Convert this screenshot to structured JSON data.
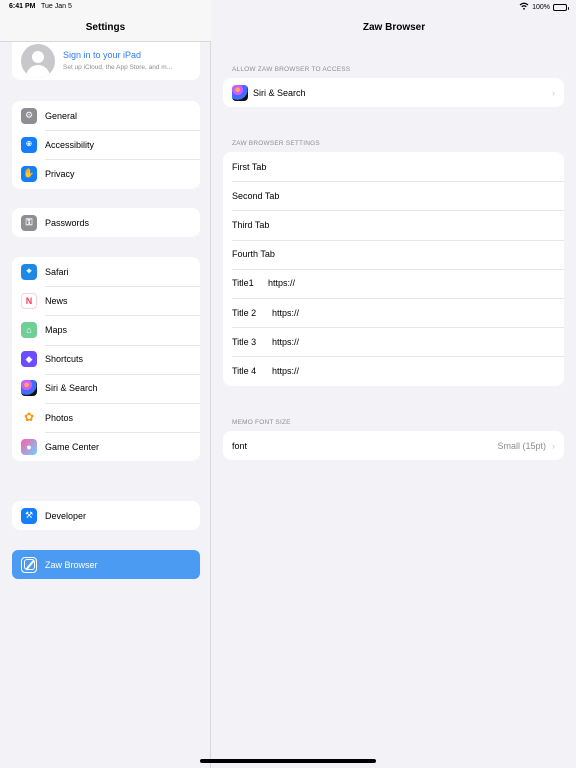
{
  "status": {
    "time": "6:41 PM",
    "date": "Tue Jan 5",
    "battery": "100%"
  },
  "sidebar": {
    "title": "Settings",
    "profile": {
      "title": "Sign in to your iPad",
      "subtitle": "Set up iCloud, the App Store, and m..."
    },
    "groups": [
      [
        {
          "label": "General",
          "icon": "gear-icon",
          "color": "#8e8e93"
        },
        {
          "label": "Accessibility",
          "icon": "accessibility-icon",
          "color": "#147efb"
        },
        {
          "label": "Privacy",
          "icon": "hand-icon",
          "color": "#147efb"
        }
      ],
      [
        {
          "label": "Passwords",
          "icon": "key-icon",
          "color": "#8e8e93"
        }
      ],
      [
        {
          "label": "Safari",
          "icon": "compass-icon",
          "color": "#1e88e5"
        },
        {
          "label": "News",
          "icon": "news-icon",
          "color": "#ff3b58"
        },
        {
          "label": "Maps",
          "icon": "maps-icon",
          "color": "#6fcf97"
        },
        {
          "label": "Shortcuts",
          "icon": "shortcuts-icon",
          "color": "#6d4dff"
        },
        {
          "label": "Siri & Search",
          "icon": "siri-icon",
          "color": "#222"
        },
        {
          "label": "Photos",
          "icon": "photos-icon",
          "color": "#ff9500"
        },
        {
          "label": "Game Center",
          "icon": "game-center-icon",
          "color": "#ff5ea8"
        }
      ],
      [
        {
          "label": "Developer",
          "icon": "hammer-icon",
          "color": "#147efb"
        }
      ]
    ],
    "selected": {
      "label": "Zaw Browser",
      "icon": "zaw-browser-icon",
      "color": "#4b9bf3"
    }
  },
  "main": {
    "title": "Zaw Browser",
    "access_section": {
      "title": "ALLOW ZAW BROWSER TO ACCESS",
      "items": [
        {
          "label": "Siri & Search",
          "icon": "siri-icon"
        }
      ]
    },
    "settings_section": {
      "title": "ZAW BROWSER SETTINGS",
      "tabs": [
        "First Tab",
        "Second Tab",
        "Third Tab",
        "Fourth Tab"
      ],
      "titles": [
        {
          "label": "Title1",
          "value": "https://"
        },
        {
          "label": "Title 2",
          "value": "https://"
        },
        {
          "label": "Title 3",
          "value": "https://"
        },
        {
          "label": "Title 4",
          "value": "https://"
        }
      ]
    },
    "memo_section": {
      "title": "MEMO FONT SIZE",
      "font": {
        "label": "font",
        "value": "Small (15pt)"
      }
    }
  }
}
